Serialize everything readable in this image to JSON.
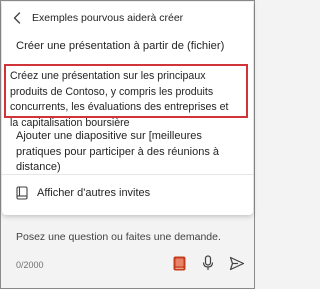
{
  "header": {
    "back_icon": "chevron-left-icon",
    "title": "Exemples pourvous aiderà créer"
  },
  "suggestions": [
    {
      "text": "Créer une présentation à partir de (fichier)"
    },
    {
      "text": "Créez une présentation sur les principaux produits de Contoso, y compris les produits concurrents, les évaluations des entreprises et la capitalisation boursière",
      "highlighted": true,
      "highlight_color": "#d13438"
    },
    {
      "text": "Ajouter une diapositive sur [meilleures pratiques pour participer à des réunions à distance)"
    }
  ],
  "more_prompts": {
    "icon": "book-icon",
    "label": "Afficher d'autres invites"
  },
  "composer": {
    "placeholder": "Posez une question ou faites une demande.",
    "counter": "0/2000",
    "prompts_icon": "prompt-book-icon",
    "prompts_icon_color": "#c43e1c",
    "mic_icon": "microphone-icon",
    "send_icon": "send-icon"
  }
}
